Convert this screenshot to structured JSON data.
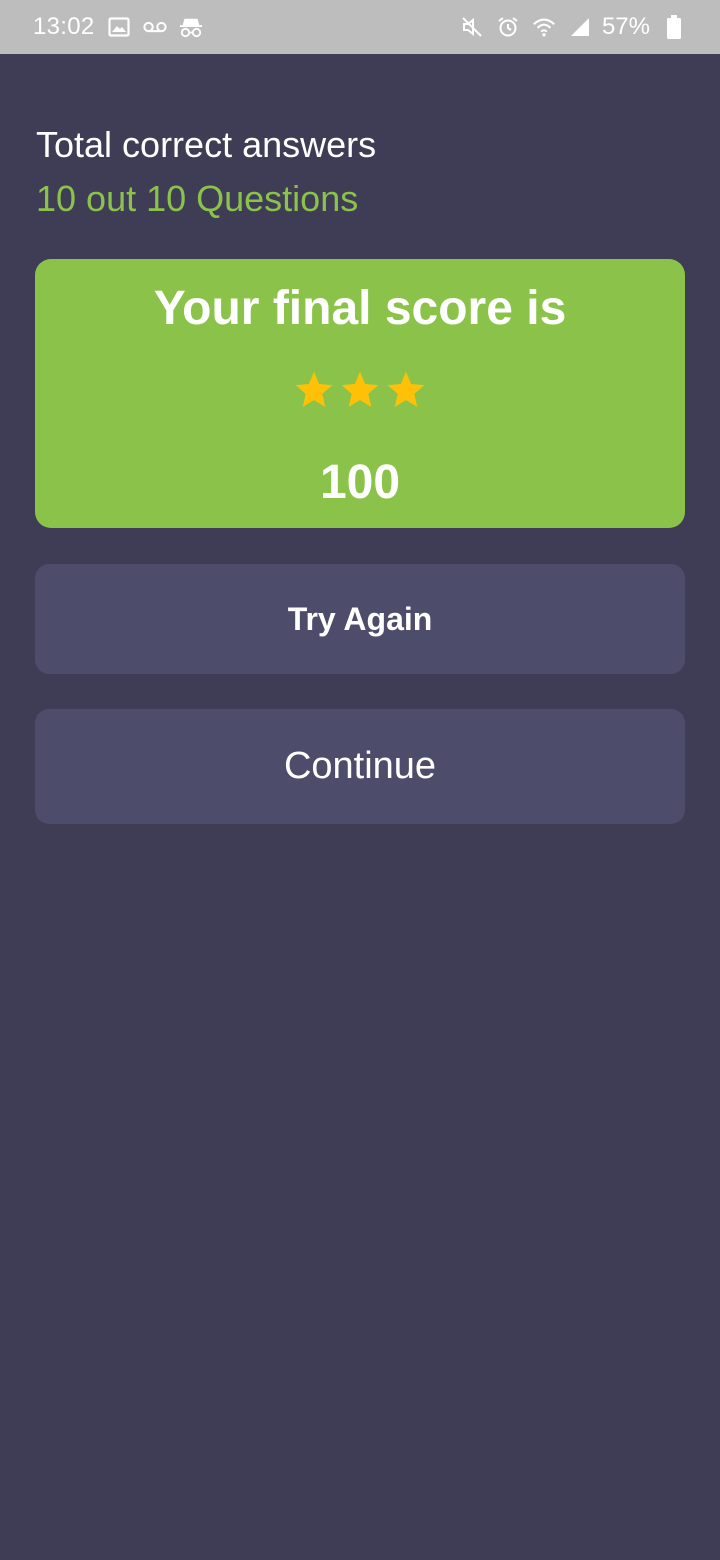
{
  "status_bar": {
    "time": "13:02",
    "battery": "57%",
    "left_icons": [
      "image-icon",
      "voicemail-icon",
      "incognito-icon"
    ],
    "right_icons": [
      "mute-icon",
      "alarm-icon",
      "wifi-icon",
      "signal-icon",
      "battery-icon"
    ]
  },
  "summary": {
    "label": "Total correct answers",
    "value": "10 out 10 Questions"
  },
  "score_card": {
    "title": "Your final score is",
    "stars_filled": 3,
    "stars_total": 3,
    "score": "100"
  },
  "actions": {
    "try_again": "Try Again",
    "continue": "Continue"
  },
  "colors": {
    "background": "#3f3c55",
    "accent_green": "#8bc34a",
    "button_bg": "#4e4c6b",
    "star": "#ffc107",
    "status_bar": "#bdbdbd"
  }
}
